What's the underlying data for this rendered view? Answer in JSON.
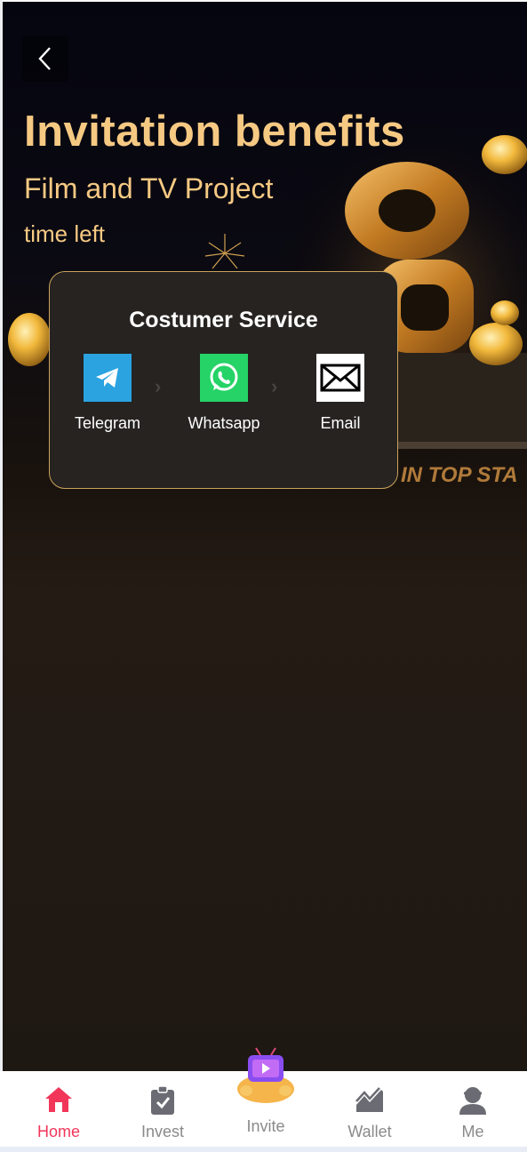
{
  "hero": {
    "title": "Invitation benefits",
    "subtitle": "Film and TV Project",
    "time_left": "time left",
    "banner_text": "IN TOP STA"
  },
  "modal": {
    "title": "Costumer Service",
    "services": [
      {
        "label": "Telegram",
        "icon": "telegram-icon",
        "color": "#2aa3e0"
      },
      {
        "label": "Whatsapp",
        "icon": "whatsapp-icon",
        "color": "#25d366"
      },
      {
        "label": "Email",
        "icon": "email-icon",
        "color": "#ffffff"
      }
    ]
  },
  "tabbar": {
    "items": [
      {
        "label": "Home",
        "icon": "home-icon",
        "active": true
      },
      {
        "label": "Invest",
        "icon": "clipboard-check-icon",
        "active": false
      },
      {
        "label": "Invite",
        "icon": "invite-tv-icon",
        "active": false
      },
      {
        "label": "Wallet",
        "icon": "chart-icon",
        "active": false
      },
      {
        "label": "Me",
        "icon": "user-icon",
        "active": false
      }
    ],
    "active_color": "#f2365a"
  },
  "colors": {
    "gold": "#f6c983",
    "modal_border": "#caa35c"
  }
}
